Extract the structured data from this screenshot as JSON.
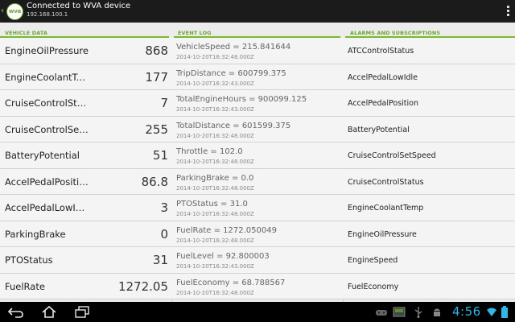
{
  "app": {
    "title": "Connected to WVA device",
    "subtitle": "192.168.100.1",
    "logo_text": "wva",
    "back_glyph": "‹"
  },
  "vehicle_panel": {
    "header": "VEHICLE DATA",
    "rows": [
      {
        "name": "EngineOilPressure",
        "value": "868"
      },
      {
        "name": "EngineCoolantTemp",
        "value": "177"
      },
      {
        "name": "CruiseControlStatus",
        "value": "7"
      },
      {
        "name": "CruiseControlSetSpeed",
        "value": "255"
      },
      {
        "name": "BatteryPotential",
        "value": "51"
      },
      {
        "name": "AccelPedalPosition",
        "value": "86.8"
      },
      {
        "name": "AccelPedalLowIdle",
        "value": "3"
      },
      {
        "name": "ParkingBrake",
        "value": "0"
      },
      {
        "name": "PTOStatus",
        "value": "31"
      },
      {
        "name": "FuelRate",
        "value": "1272.05"
      }
    ]
  },
  "event_panel": {
    "header": "EVENT LOG",
    "rows": [
      {
        "text": "VehicleSpeed = 215.841644",
        "time": "2014-10-20T16:32:48.000Z"
      },
      {
        "text": "TripDistance = 600799.375",
        "time": "2014-10-20T16:32:43.000Z"
      },
      {
        "text": "TotalEngineHours = 900099.125",
        "time": "2014-10-20T16:32:43.000Z"
      },
      {
        "text": "TotalDistance = 601599.375",
        "time": "2014-10-20T16:32:48.000Z"
      },
      {
        "text": "Throttle = 102.0",
        "time": "2014-10-20T16:32:48.000Z"
      },
      {
        "text": "ParkingBrake = 0.0",
        "time": "2014-10-20T16:32:48.000Z"
      },
      {
        "text": "PTOStatus = 31.0",
        "time": "2014-10-20T16:32:48.000Z"
      },
      {
        "text": "FuelRate = 1272.050049",
        "time": "2014-10-20T16:32:48.000Z"
      },
      {
        "text": "FuelLevel = 92.800003",
        "time": "2014-10-20T16:32:43.000Z"
      },
      {
        "text": "FuelEconomy = 68.788567",
        "time": "2014-10-20T16:32:48.000Z"
      }
    ]
  },
  "alarms_panel": {
    "header": "ALARMS AND SUBSCRIPTIONS",
    "rows": [
      {
        "name": "ATCControlStatus"
      },
      {
        "name": "AccelPedalLowIdle"
      },
      {
        "name": "AccelPedalPosition"
      },
      {
        "name": "BatteryPotential"
      },
      {
        "name": "CruiseControlSetSpeed"
      },
      {
        "name": "CruiseControlStatus"
      },
      {
        "name": "EngineCoolantTemp"
      },
      {
        "name": "EngineOilPressure"
      },
      {
        "name": "EngineSpeed"
      },
      {
        "name": "FuelEconomy"
      }
    ]
  },
  "system_bar": {
    "time": "4:56",
    "accent_color": "#33b5e5",
    "left_icons": [
      "back-icon",
      "home-icon",
      "recent-apps-icon"
    ],
    "right_icons": [
      "gamepad-icon",
      "screenshot-icon",
      "usb-icon",
      "android-debug-icon",
      "wifi-icon",
      "battery-icon"
    ]
  },
  "colors": {
    "accent_green": "#7cb82f",
    "action_bar": "#1b1b1b",
    "background": "#ececec"
  }
}
